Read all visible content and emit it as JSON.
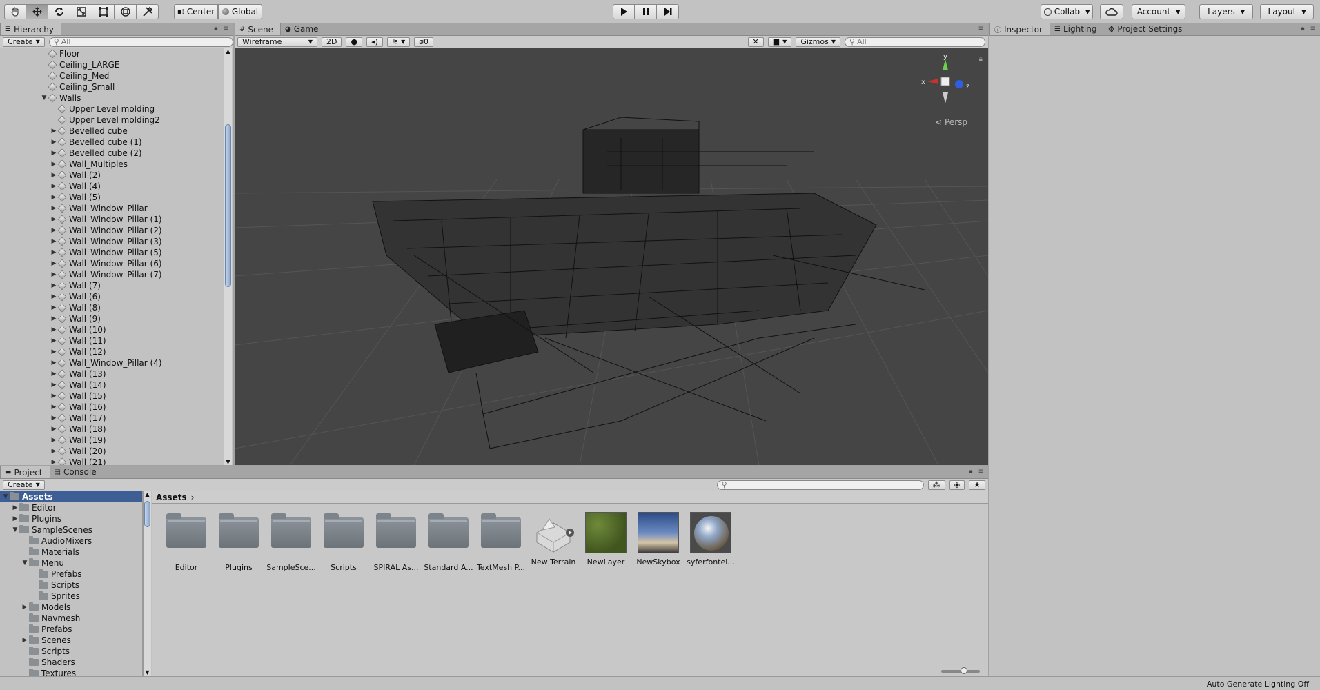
{
  "toolbar": {
    "tools": [
      "hand-tool",
      "move-tool",
      "rotate-tool",
      "scale-tool",
      "rect-tool",
      "transform-tool",
      "custom-tool"
    ],
    "pivot_mode": "Center",
    "pivot_rotation": "Global",
    "collab": "Collab",
    "account": "Account",
    "layers": "Layers",
    "layout": "Layout"
  },
  "hierarchy": {
    "tab": "Hierarchy",
    "create": "Create",
    "search_placeholder": "All",
    "items": [
      {
        "label": "Floor",
        "indent": 0,
        "expander": ""
      },
      {
        "label": "Ceiling_LARGE",
        "indent": 0,
        "expander": ""
      },
      {
        "label": "Ceiling_Med",
        "indent": 0,
        "expander": ""
      },
      {
        "label": "Ceiling_Small",
        "indent": 0,
        "expander": ""
      },
      {
        "label": "Walls",
        "indent": 0,
        "expander": "open"
      },
      {
        "label": "Upper Level molding",
        "indent": 1,
        "expander": ""
      },
      {
        "label": "Upper Level molding2",
        "indent": 1,
        "expander": ""
      },
      {
        "label": "Bevelled cube",
        "indent": 1,
        "expander": "closed"
      },
      {
        "label": "Bevelled cube (1)",
        "indent": 1,
        "expander": "closed"
      },
      {
        "label": "Bevelled cube (2)",
        "indent": 1,
        "expander": "closed"
      },
      {
        "label": "Wall_Multiples",
        "indent": 1,
        "expander": "closed"
      },
      {
        "label": "Wall (2)",
        "indent": 1,
        "expander": "closed"
      },
      {
        "label": "Wall (4)",
        "indent": 1,
        "expander": "closed"
      },
      {
        "label": "Wall (5)",
        "indent": 1,
        "expander": "closed"
      },
      {
        "label": "Wall_Window_Pillar",
        "indent": 1,
        "expander": "closed"
      },
      {
        "label": "Wall_Window_Pillar (1)",
        "indent": 1,
        "expander": "closed"
      },
      {
        "label": "Wall_Window_Pillar (2)",
        "indent": 1,
        "expander": "closed"
      },
      {
        "label": "Wall_Window_Pillar (3)",
        "indent": 1,
        "expander": "closed"
      },
      {
        "label": "Wall_Window_Pillar (5)",
        "indent": 1,
        "expander": "closed"
      },
      {
        "label": "Wall_Window_Pillar (6)",
        "indent": 1,
        "expander": "closed"
      },
      {
        "label": "Wall_Window_Pillar (7)",
        "indent": 1,
        "expander": "closed"
      },
      {
        "label": "Wall (7)",
        "indent": 1,
        "expander": "closed"
      },
      {
        "label": "Wall (6)",
        "indent": 1,
        "expander": "closed"
      },
      {
        "label": "Wall (8)",
        "indent": 1,
        "expander": "closed"
      },
      {
        "label": "Wall (9)",
        "indent": 1,
        "expander": "closed"
      },
      {
        "label": "Wall (10)",
        "indent": 1,
        "expander": "closed"
      },
      {
        "label": "Wall (11)",
        "indent": 1,
        "expander": "closed"
      },
      {
        "label": "Wall (12)",
        "indent": 1,
        "expander": "closed"
      },
      {
        "label": "Wall_Window_Pillar (4)",
        "indent": 1,
        "expander": "closed"
      },
      {
        "label": "Wall (13)",
        "indent": 1,
        "expander": "closed"
      },
      {
        "label": "Wall (14)",
        "indent": 1,
        "expander": "closed"
      },
      {
        "label": "Wall (15)",
        "indent": 1,
        "expander": "closed"
      },
      {
        "label": "Wall (16)",
        "indent": 1,
        "expander": "closed"
      },
      {
        "label": "Wall (17)",
        "indent": 1,
        "expander": "closed"
      },
      {
        "label": "Wall (18)",
        "indent": 1,
        "expander": "closed"
      },
      {
        "label": "Wall (19)",
        "indent": 1,
        "expander": "closed"
      },
      {
        "label": "Wall (20)",
        "indent": 1,
        "expander": "closed"
      },
      {
        "label": "Wall (21)",
        "indent": 1,
        "expander": "closed"
      }
    ]
  },
  "scene": {
    "tabs": [
      "Scene",
      "Game"
    ],
    "shading_mode": "Wireframe",
    "mode_2d": "2D",
    "effects_count": "0",
    "gizmos": "Gizmos",
    "search_placeholder": "All",
    "projection": "Persp",
    "axis_labels": {
      "y": "y",
      "x": "x",
      "z": "z"
    }
  },
  "inspector": {
    "tabs": [
      "Inspector",
      "Lighting",
      "Project Settings"
    ]
  },
  "project": {
    "tabs": [
      "Project",
      "Console"
    ],
    "create": "Create",
    "tree": [
      {
        "label": "Assets",
        "indent": 0,
        "expander": "open",
        "selected": true
      },
      {
        "label": "Editor",
        "indent": 1,
        "expander": "closed"
      },
      {
        "label": "Plugins",
        "indent": 1,
        "expander": "closed"
      },
      {
        "label": "SampleScenes",
        "indent": 1,
        "expander": "open"
      },
      {
        "label": "AudioMixers",
        "indent": 2,
        "expander": ""
      },
      {
        "label": "Materials",
        "indent": 2,
        "expander": ""
      },
      {
        "label": "Menu",
        "indent": 2,
        "expander": "open"
      },
      {
        "label": "Prefabs",
        "indent": 3,
        "expander": ""
      },
      {
        "label": "Scripts",
        "indent": 3,
        "expander": ""
      },
      {
        "label": "Sprites",
        "indent": 3,
        "expander": ""
      },
      {
        "label": "Models",
        "indent": 2,
        "expander": "closed"
      },
      {
        "label": "Navmesh",
        "indent": 2,
        "expander": ""
      },
      {
        "label": "Prefabs",
        "indent": 2,
        "expander": ""
      },
      {
        "label": "Scenes",
        "indent": 2,
        "expander": "closed"
      },
      {
        "label": "Scripts",
        "indent": 2,
        "expander": ""
      },
      {
        "label": "Shaders",
        "indent": 2,
        "expander": ""
      },
      {
        "label": "Textures",
        "indent": 2,
        "expander": ""
      }
    ],
    "breadcrumb": "Assets",
    "assets": [
      {
        "label": "Editor",
        "kind": "folder"
      },
      {
        "label": "Plugins",
        "kind": "folder"
      },
      {
        "label": "SampleSce...",
        "kind": "folder"
      },
      {
        "label": "Scripts",
        "kind": "folder"
      },
      {
        "label": "SPIRAL As...",
        "kind": "folder"
      },
      {
        "label": "Standard A...",
        "kind": "folder"
      },
      {
        "label": "TextMesh P...",
        "kind": "folder"
      },
      {
        "label": "New Terrain",
        "kind": "terrain"
      },
      {
        "label": "NewLayer",
        "kind": "grass"
      },
      {
        "label": "NewSkybox",
        "kind": "sky"
      },
      {
        "label": "syferfontei...",
        "kind": "sphere"
      }
    ]
  },
  "status": {
    "right": "Auto Generate Lighting Off"
  }
}
